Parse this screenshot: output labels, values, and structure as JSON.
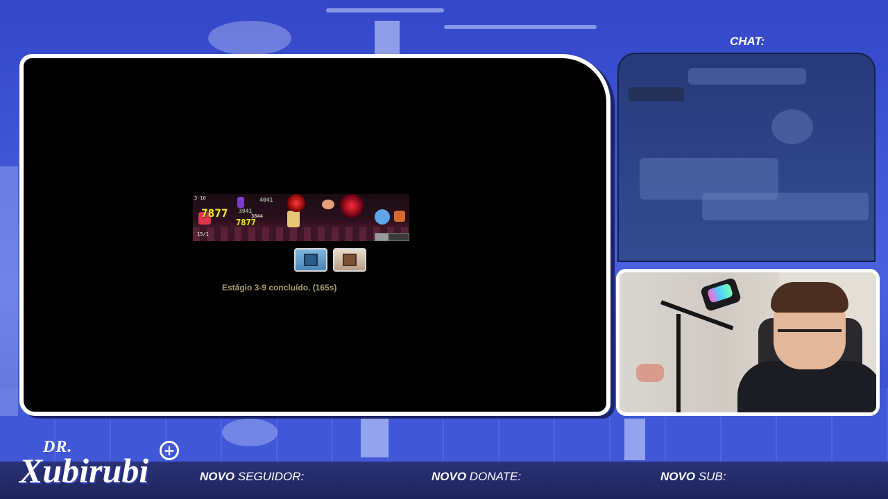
{
  "chat": {
    "title": "CHAT:"
  },
  "game": {
    "stage_text": "Estágio 3-9 concluído. (165s)",
    "hud": {
      "stage": "3-10",
      "count": "15/1"
    },
    "damage_numbers": [
      "7877",
      "7877",
      "3941",
      "3844",
      "4041"
    ],
    "icons": [
      "backpack-icon",
      "chest-icon"
    ]
  },
  "logo": {
    "prefix": "DR.",
    "name": "Xubirubi",
    "plus": "+"
  },
  "ticker": [
    {
      "bold": "NOVO",
      "rest": "SEGUIDOR:"
    },
    {
      "bold": "NOVO",
      "rest": "DONATE:"
    },
    {
      "bold": "NOVO",
      "rest": "SUB:"
    }
  ],
  "colors": {
    "accent": "#3a52d6",
    "frame": "#ffffff",
    "bar": "#1d245c",
    "stage_text": "#a89d6b",
    "damage": "#f0ee3a"
  }
}
